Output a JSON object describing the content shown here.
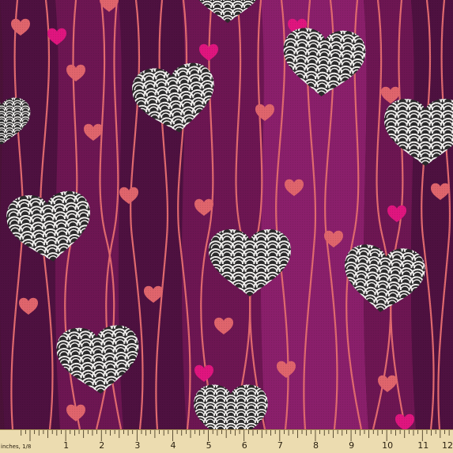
{
  "fabric": {
    "colors": {
      "stripe_dark": "#4e1140",
      "stripe_mid": "#6d1652",
      "stripe_bright": "#8a1f6b",
      "vine": "#e26a6f",
      "heart_coral": "#e0656c",
      "heart_magenta": "#e0157f",
      "heart_outline": "#2b2a2b",
      "heart_fill": "#f3f1ef"
    }
  },
  "ruler": {
    "unit_label": "inches, 1/8",
    "numbers": [
      "1",
      "2",
      "3",
      "4",
      "5",
      "6",
      "7",
      "8",
      "9",
      "10",
      "11",
      "12"
    ],
    "color": "#ecdcb0"
  }
}
